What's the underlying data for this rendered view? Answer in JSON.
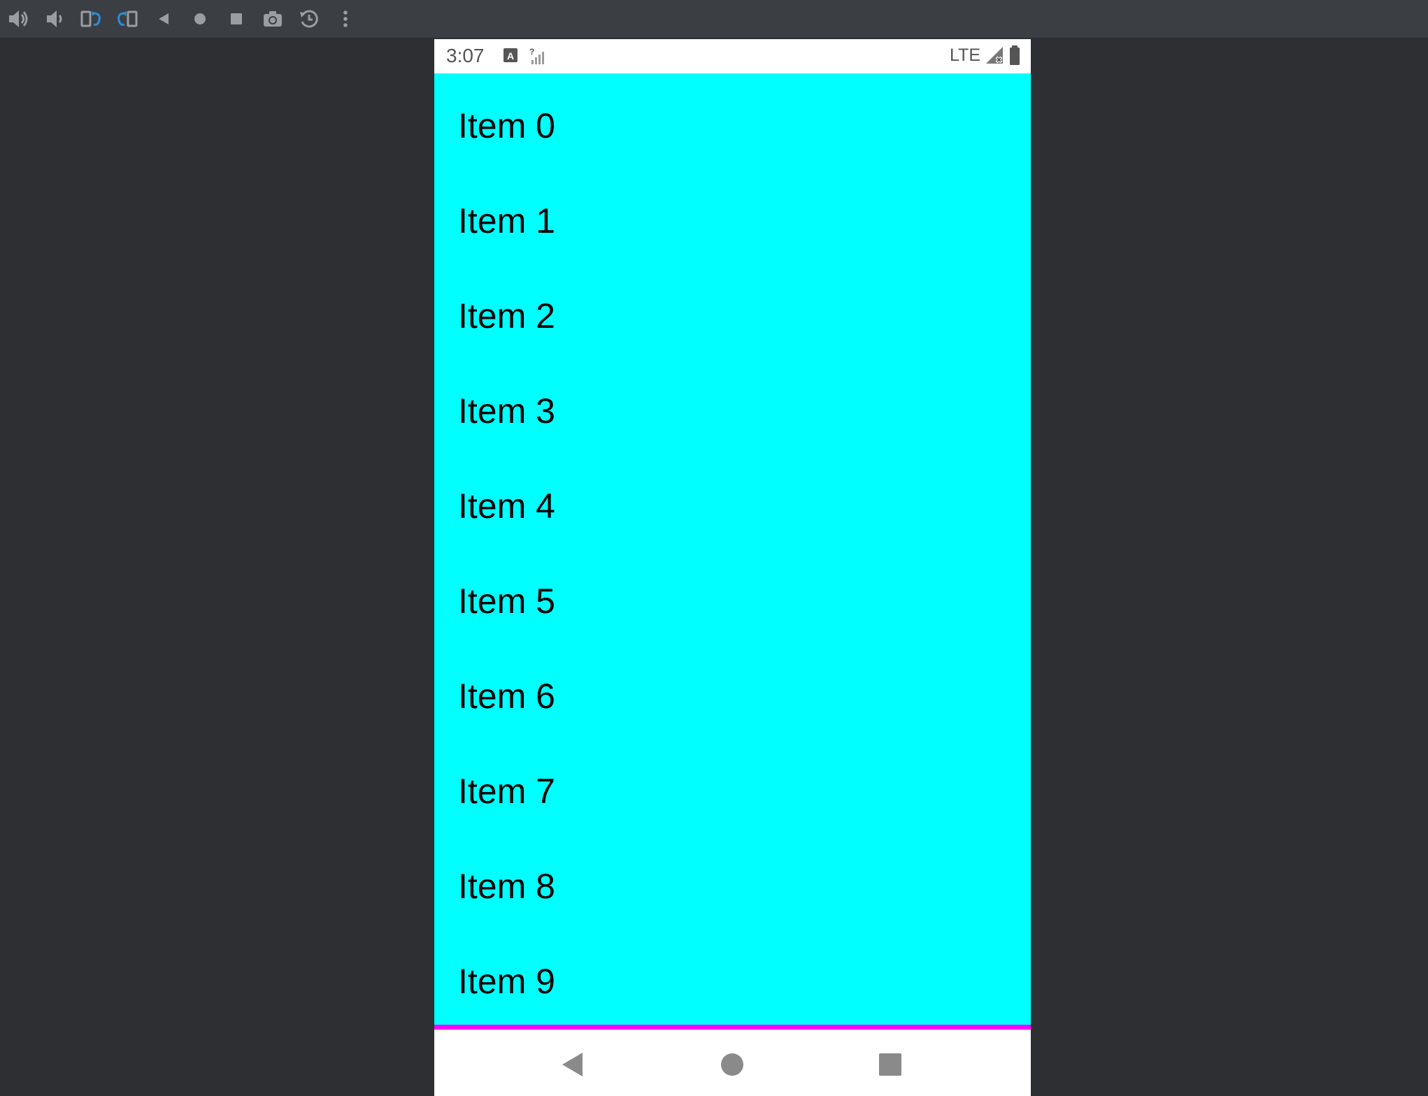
{
  "colors": {
    "desktop_background": "#2e2f32",
    "toolbar_background": "#3b3e42",
    "list_background": "#00ffff",
    "accent_line": "#ff00ff",
    "rotate_icon_accent": "#2a8fd6"
  },
  "emulator_toolbar": {
    "buttons": [
      {
        "icon": "volume-up-icon"
      },
      {
        "icon": "volume-down-icon"
      },
      {
        "icon": "rotate-left-icon"
      },
      {
        "icon": "rotate-right-icon"
      },
      {
        "icon": "back-icon"
      },
      {
        "icon": "home-icon"
      },
      {
        "icon": "overview-icon"
      },
      {
        "icon": "camera-icon"
      },
      {
        "icon": "snapshot-icon"
      },
      {
        "icon": "more-icon"
      }
    ]
  },
  "status_bar": {
    "time": "3:07",
    "network": "LTE"
  },
  "list": {
    "items": [
      {
        "label": "Item 0"
      },
      {
        "label": "Item 1"
      },
      {
        "label": "Item 2"
      },
      {
        "label": "Item 3"
      },
      {
        "label": "Item 4"
      },
      {
        "label": "Item 5"
      },
      {
        "label": "Item 6"
      },
      {
        "label": "Item 7"
      },
      {
        "label": "Item 8"
      },
      {
        "label": "Item 9"
      }
    ]
  },
  "nav_bar": {
    "buttons": [
      {
        "icon": "nav-back-icon"
      },
      {
        "icon": "nav-home-icon"
      },
      {
        "icon": "nav-recents-icon"
      }
    ]
  }
}
